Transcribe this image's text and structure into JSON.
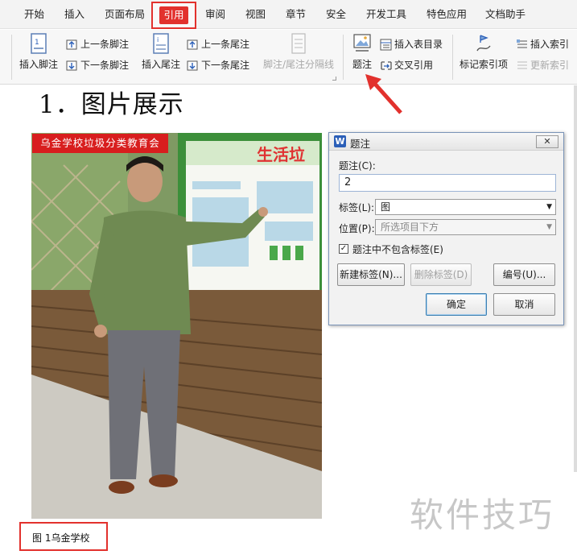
{
  "menu": {
    "items": [
      "开始",
      "插入",
      "页面布局",
      "审阅",
      "视图",
      "章节",
      "安全",
      "开发工具",
      "特色应用",
      "文档助手"
    ],
    "active": "引用"
  },
  "ribbon": {
    "insert_footnote": "插入脚注",
    "prev_footnote": "上一条脚注",
    "next_footnote": "下一条脚注",
    "insert_endnote": "插入尾注",
    "prev_endnote": "上一条尾注",
    "next_endnote": "下一条尾注",
    "separator_line": "脚注/尾注分隔线",
    "caption": "题注",
    "insert_toc_table": "插入表目录",
    "cross_reference": "交叉引用",
    "mark_index": "标记索引项",
    "insert_index": "插入索引",
    "update_index": "更新索引"
  },
  "document": {
    "heading": "1．图片展示",
    "photo_banner": "乌金学校垃圾分类教育会",
    "poster_title": "生活垃",
    "caption": "图 1乌金学校",
    "watermark": "软件技巧"
  },
  "dialog": {
    "title": "题注",
    "caption_label": "题注(C):",
    "caption_value": "2",
    "tag_label": "标签(L):",
    "tag_value": "图",
    "position_label": "位置(P):",
    "position_value": "所选项目下方",
    "exclude_label_text": "题注中不包含标签(E)",
    "exclude_label_checked": true,
    "new_label_button": "新建标签(N)...",
    "delete_label_button": "删除标签(D)",
    "numbering_button": "编号(U)...",
    "ok_button": "确定",
    "cancel_button": "取消"
  },
  "colors": {
    "highlight_red": "#e2312d",
    "banner_red": "#d81e1e",
    "dialog_blue": "#2b5fb8"
  }
}
